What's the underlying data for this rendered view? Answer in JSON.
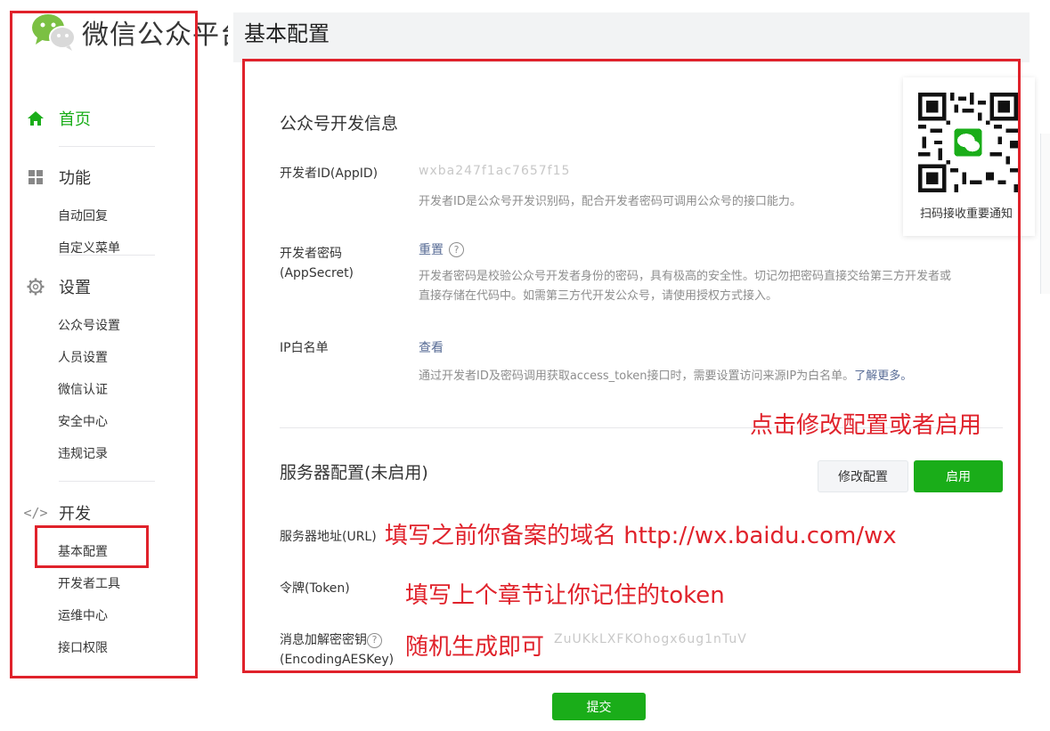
{
  "header": {
    "brand": "微信公众平台",
    "page_title": "基本配置"
  },
  "sidebar": {
    "home": "首页",
    "function": {
      "label": "功能",
      "items": [
        "自动回复",
        "自定义菜单"
      ]
    },
    "settings": {
      "label": "设置",
      "items": [
        "公众号设置",
        "人员设置",
        "微信认证",
        "安全中心",
        "违规记录"
      ]
    },
    "develop": {
      "label": "开发",
      "items": [
        "基本配置",
        "开发者工具",
        "运维中心",
        "接口权限"
      ]
    }
  },
  "dev_info": {
    "title": "公众号开发信息",
    "appid_label": "开发者ID(AppID)",
    "appid_value": "wxba247f1ac7657f15",
    "appid_desc": "开发者ID是公众号开发识别码，配合开发者密码可调用公众号的接口能力。",
    "secret_label_1": "开发者密码",
    "secret_label_2": "(AppSecret)",
    "secret_action": "重置",
    "secret_desc_1": "开发者密码是校验公众号开发者身份的密码，具有极高的安全性。切记勿把密码直接交给第三方开发者或",
    "secret_desc_2": "直接存储在代码中。如需第三方代开发公众号，请使用授权方式接入。",
    "ip_label": "IP白名单",
    "ip_action": "查看",
    "ip_desc": "通过开发者ID及密码调用获取access_token接口时，需要设置访问来源IP为白名单。",
    "ip_learn_more": "了解更多。"
  },
  "server_config": {
    "title": "服务器配置(未启用)",
    "modify_button": "修改配置",
    "enable_button": "启用",
    "url_label": "服务器地址(URL)",
    "token_label": "令牌(Token)",
    "aes_label_1": "消息加解密密钥",
    "aes_label_2": "(EncodingAESKey)",
    "aes_value": "ZuUKkLXFKOhogx6ug1nTuV"
  },
  "submit_button": "提交",
  "qr": {
    "caption": "扫码接收重要通知"
  },
  "annotations": {
    "modify_hint": "点击修改配置或者启用",
    "url_hint": "填写之前你备案的域名 http://wx.baidu.com/wx",
    "token_hint": "填写上个章节让你记住的token",
    "aes_hint": "随机生成即可"
  },
  "colors": {
    "accent_green": "#1aad19",
    "annotation_red": "#e0222b",
    "link_blue": "#576b95"
  }
}
